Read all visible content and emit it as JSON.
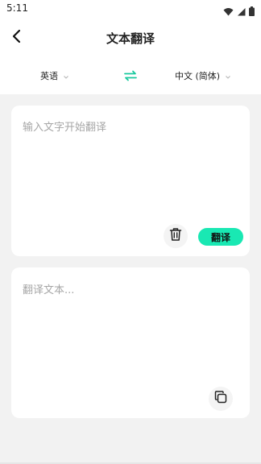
{
  "status_bar": {
    "time": "5:11",
    "icons": [
      "wifi-icon",
      "signal-icon",
      "battery-icon"
    ]
  },
  "nav": {
    "title": "文本翻译",
    "back_icon": "chevron-left-icon"
  },
  "languages": {
    "source": "英语",
    "target": "中文 (简体)",
    "swap_icon": "swap-arrows-icon"
  },
  "input_card": {
    "placeholder": "输入文字开始翻译",
    "value": "",
    "delete_icon": "trash-icon",
    "translate_label": "翻译"
  },
  "output_card": {
    "placeholder": "翻译文本...",
    "copy_icon": "copy-icon"
  },
  "colors": {
    "accent": "#19e8b3",
    "background": "#f2f2f2",
    "card": "#ffffff",
    "placeholder": "#a6a6a6"
  }
}
